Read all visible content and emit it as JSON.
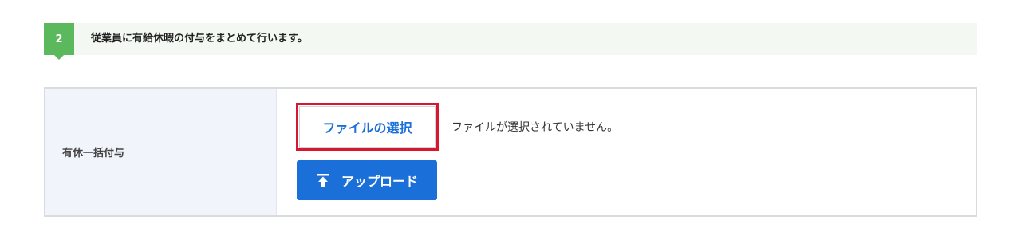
{
  "step": {
    "number": "2",
    "text": "従業員に有給休暇の付与をまとめて行います。"
  },
  "form": {
    "label": "有休一括付与",
    "file_button_label": "ファイルの選択",
    "file_status": "ファイルが選択されていません。",
    "upload_button_label": "アップロード",
    "upload_icon": "upload-icon"
  },
  "colors": {
    "accent_green": "#5cb85c",
    "primary_blue": "#1a6fd8",
    "highlight_red": "#d7172f"
  }
}
